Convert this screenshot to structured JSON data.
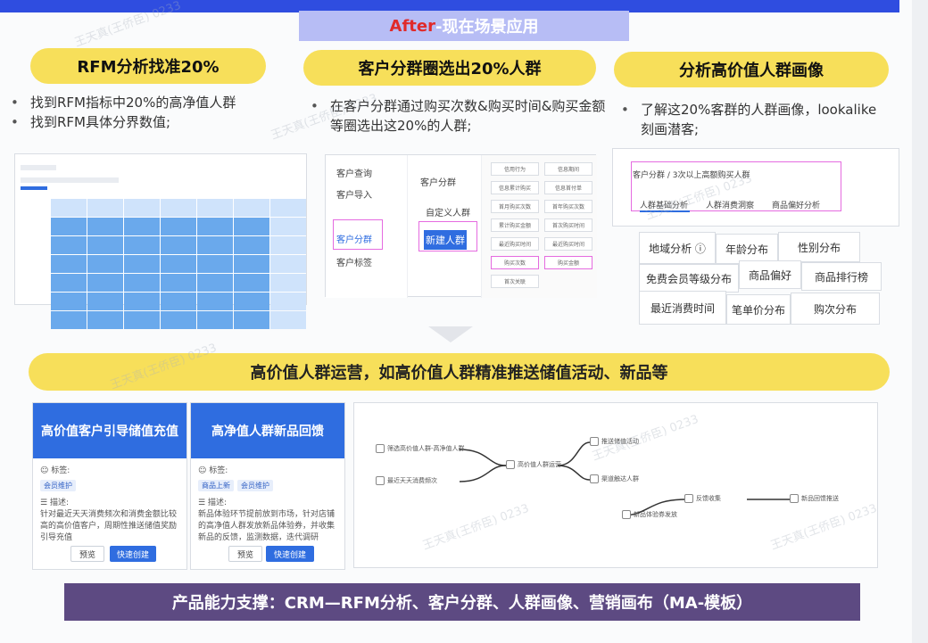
{
  "banner": {
    "after": "After",
    "rest": "-现在场景应用"
  },
  "pills": {
    "rfm": "RFM分析找准20%",
    "segment": "客户分群圈选出20%人群",
    "profile": "分析高价值人群画像"
  },
  "bullets": {
    "rfm": [
      "找到RFM指标中20%的高净值人群",
      "找到RFM具体分界数值;"
    ],
    "segment": [
      "在客户分群通过购买次数&购买时间&购买金额等圈选出这20%的人群;"
    ],
    "profile": [
      "了解这20%客群的人群画像，lookalike刻画潜客;"
    ]
  },
  "segment_shot": {
    "menu": [
      "客户查询",
      "客户导入",
      "客户分群",
      "客户标签"
    ],
    "title": "客户分群",
    "sub": "自定义人群",
    "button": "新建人群",
    "criteria": [
      "信用行为",
      "信息期间",
      "信息累计购买",
      "信息首付单",
      "首月购买次数",
      "首年购买次数",
      "累计购买金额",
      "首次购买时间",
      "最近购买时间",
      "最近购买时间",
      "购买次数",
      "购买金额",
      "首次关联"
    ]
  },
  "profile_shot": {
    "breadcrumb": "客户分群 / 3次以上高额购买人群",
    "tabs": [
      "人群基础分析",
      "人群消费洞察",
      "商品偏好分析"
    ]
  },
  "attributes": [
    "地域分析 ⓘ",
    "年龄分布",
    "性别分布",
    "免费会员等级分布",
    "商品偏好",
    "商品排行榜",
    "最近消费时间",
    "笔单价分布",
    "购次分布"
  ],
  "big_pill": "高价值人群运营，如高价值人群精准推送储值活动、新品等",
  "cards": [
    {
      "title": "高价值客户引导储值充值",
      "tag_label": "标签:",
      "tags": [
        "会员维护"
      ],
      "desc_label": "描述:",
      "desc": "针对最近天天消费频次和消费金额比较高的高价值客户，周期性推送储值奖励引导充值",
      "btn_preview": "预览",
      "btn_create": "快速创建"
    },
    {
      "title": "高净值人群新品回馈",
      "tag_label": "标签:",
      "tags": [
        "商品上新",
        "会员维护"
      ],
      "desc_label": "描述:",
      "desc": "新品体验环节提前放到市场，针对店铺的高净值人群发放新品体验券，并收集新品的反馈，监测数据，迭代调研",
      "btn_preview": "预览",
      "btn_create": "快速创建"
    }
  ],
  "flow_nodes": [
    "筛选高价值人群-高净值人群",
    "最近天天消费频次",
    "推送储值活动",
    "渠道触达人群",
    "新品体验券发放",
    "高价值人群运营",
    "反馈收集",
    "新品回馈推送"
  ],
  "bottom_bar": "产品能力支撑：CRM—RFM分析、客户分群、人群画像、营销画布（MA-模板）",
  "watermark": "王天真(王侨臣) 0233",
  "colors": {
    "yellow": "#f7df5a",
    "blue": "#2f6de0",
    "purple": "#5d4a82",
    "banner": "#b7bdf5"
  }
}
